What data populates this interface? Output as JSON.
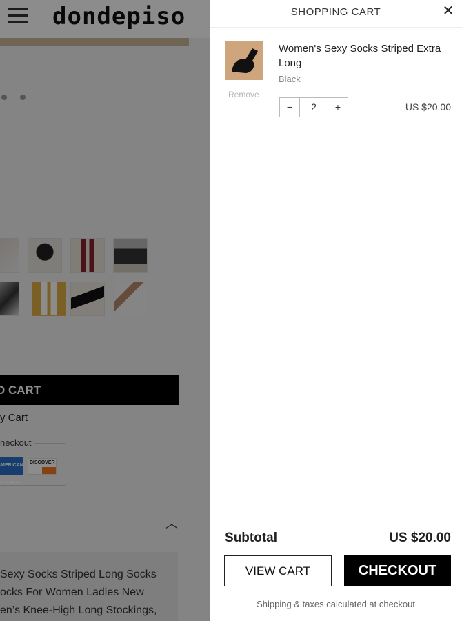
{
  "background_page": {
    "logo": "dondepiso",
    "add_to_cart_label": "O CART",
    "view_cart_link": "y Cart",
    "checkout_label": "heckout",
    "payment": {
      "amex": "AMERICAN EXPRESS",
      "discover": "DISCOVER"
    },
    "description_lines": [
      "Sexy Socks Striped Long Socks",
      "ocks For Women Ladies New",
      "en’s Knee-High Long Stockings,"
    ]
  },
  "cart": {
    "title": "SHOPPING CART",
    "item": {
      "name": "Women's Sexy Socks Striped Extra Long",
      "variant": "Black",
      "remove_label": "Remove",
      "quantity": "2",
      "minus": "−",
      "plus": "+",
      "price": "US $20.00"
    },
    "subtotal_label": "Subtotal",
    "subtotal_value": "US $20.00",
    "view_cart_label": "VIEW CART",
    "checkout_label": "CHECKOUT",
    "shipping_note": "Shipping & taxes calculated at checkout"
  }
}
